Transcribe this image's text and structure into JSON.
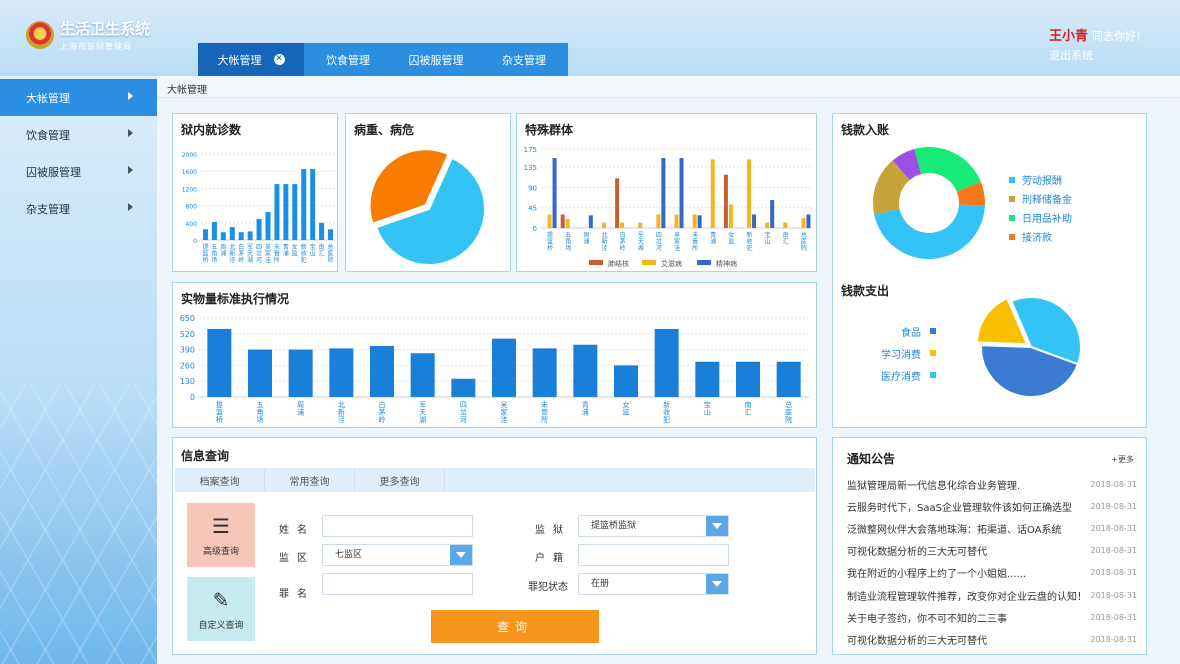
{
  "header": {
    "title": "生活卫生系统",
    "subtitle": "上海市监狱管理局",
    "user_name": "王小青",
    "greeting": "同志你好！",
    "logout": "退出系统"
  },
  "tabs": [
    {
      "label": "大帐管理"
    },
    {
      "label": "饮食管理"
    },
    {
      "label": "囚被服管理"
    },
    {
      "label": "杂支管理"
    }
  ],
  "sidebar": {
    "items": [
      {
        "label": "大帐管理"
      },
      {
        "label": "饮食管理"
      },
      {
        "label": "囚被服管理"
      },
      {
        "label": "杂支管理"
      }
    ]
  },
  "breadcrumb": "大帐管理",
  "panels": {
    "clinic": "狱内就诊数",
    "illness": "病重、病危",
    "special": "特殊群体",
    "income": "钱款入账",
    "expense": "钱款支出",
    "standard": "实物量标准执行情况",
    "query": "信息查询",
    "notice": "通知公告",
    "more": "+更多"
  },
  "colors": {
    "accent": "#2a8ee2",
    "bar": "#1a8fe3",
    "orange": "#f7941d"
  },
  "chart_data": [
    {
      "type": "bar",
      "title": "狱内就诊数",
      "categories": [
        "提篮桥",
        "五角场",
        "周浦",
        "北新泾",
        "白茅岭",
        "军天湖",
        "四岔河",
        "吴家洼",
        "未管所",
        "青浦",
        "女监",
        "新收犯",
        "宝山",
        "南汇",
        "总医院"
      ],
      "values": [
        250,
        420,
        180,
        300,
        180,
        200,
        490,
        650,
        1300,
        1300,
        1300,
        1650,
        1650,
        400,
        250
      ],
      "ylim": [
        0,
        2000
      ],
      "yticks": [
        0,
        400,
        800,
        1200,
        1600,
        2000
      ]
    },
    {
      "type": "pie",
      "title": "病重、病危",
      "slices": [
        {
          "value": 63,
          "color": "#33c3f5"
        },
        {
          "value": 37,
          "color": "#f97b00"
        }
      ]
    },
    {
      "type": "bar",
      "title": "特殊群体",
      "categories": [
        "提篮桥",
        "五角场",
        "周浦",
        "北新泾",
        "白茅岭",
        "军天湖",
        "四岔河",
        "吴家洼",
        "未管所",
        "青浦",
        "女监",
        "新收犯",
        "宝山",
        "南汇",
        "总医院"
      ],
      "series": [
        {
          "name": "肺结核",
          "color": "#c85e35",
          "values": [
            0,
            30,
            0,
            0,
            110,
            0,
            0,
            0,
            0,
            0,
            118,
            0,
            0,
            0,
            0
          ]
        },
        {
          "name": "艾滋病",
          "color": "#f4b61a",
          "values": [
            30,
            20,
            0,
            12,
            12,
            12,
            30,
            30,
            30,
            152,
            52,
            152,
            12,
            12,
            22
          ]
        },
        {
          "name": "精神病",
          "color": "#3467c9",
          "values": [
            155,
            0,
            28,
            0,
            0,
            0,
            155,
            155,
            28,
            0,
            0,
            30,
            62,
            0,
            30
          ]
        }
      ],
      "ylim": [
        0,
        175
      ],
      "yticks": [
        0,
        45,
        90,
        135,
        175
      ]
    },
    {
      "type": "pie",
      "title": "钱款入账",
      "donut": true,
      "slices": [
        {
          "name": "劳动报酬",
          "value": 46,
          "color": "#33c3f5"
        },
        {
          "name": "刑释储备金",
          "value": 17,
          "color": "#c9a23a"
        },
        {
          "name": "日用品补助",
          "value": 7,
          "color": "#9b4fe3"
        },
        {
          "name": "接济款",
          "value": 23,
          "color": "#18ea77"
        },
        {
          "name": "",
          "value": 7,
          "color": "#f6781b"
        }
      ]
    },
    {
      "type": "bar",
      "title": "实物量标准执行情况",
      "categories": [
        "提篮桥",
        "五角场",
        "周浦",
        "北新泾",
        "白茅岭",
        "军天湖",
        "四岔河",
        "吴家洼",
        "未管所",
        "青浦",
        "女监",
        "新收犯",
        "宝山",
        "南汇",
        "总医院"
      ],
      "values": [
        560,
        390,
        390,
        400,
        420,
        360,
        150,
        480,
        400,
        430,
        260,
        560,
        290,
        290,
        290
      ],
      "ylim": [
        0,
        650
      ],
      "yticks": [
        0,
        130,
        260,
        390,
        520,
        650
      ]
    },
    {
      "type": "pie",
      "title": "钱款支出",
      "slices": [
        {
          "name": "食品",
          "value": 45,
          "color": "#3b7bd4"
        },
        {
          "name": "学习消费",
          "value": 18,
          "color": "#f9bf00"
        },
        {
          "name": "医疗消费",
          "value": 37,
          "color": "#33c3f5"
        }
      ]
    }
  ],
  "query": {
    "tabs": [
      "档案查询",
      "常用查询",
      "更多查询"
    ],
    "adv": "高级查询",
    "custom": "自定义查询",
    "name_label": "姓名",
    "area_label": "监区",
    "area_value": "七监区",
    "crime_label": "罪名",
    "prison_label": "监狱",
    "prison_value": "提篮桥监狱",
    "household_label": "户籍",
    "status_label": "罪犯状态",
    "status_value": "在册",
    "button": "查询"
  },
  "notices": [
    {
      "title": "监狱管理局新一代信息化综合业务管理.",
      "date": "2018-08-31"
    },
    {
      "title": "云服务时代下，SaaS企业管理软件该如何正确选型",
      "date": "2018-08-31"
    },
    {
      "title": "泛微整网伙伴大会落地珠海：拓渠道、话OA系统",
      "date": "2018-08-31"
    },
    {
      "title": "可视化数据分析的三大无可替代",
      "date": "2018-08-31"
    },
    {
      "title": "我在附近的小程序上约了一个小姐姐......",
      "date": "2018-08-31"
    },
    {
      "title": "制造业流程管理软件推荐，改变你对企业云盘的认知！",
      "date": "2018-08-31"
    },
    {
      "title": "关于电子签约，你不可不知的二三事",
      "date": "2018-08-31"
    },
    {
      "title": "可视化数据分析的三大无可替代",
      "date": "2018-08-31"
    }
  ]
}
